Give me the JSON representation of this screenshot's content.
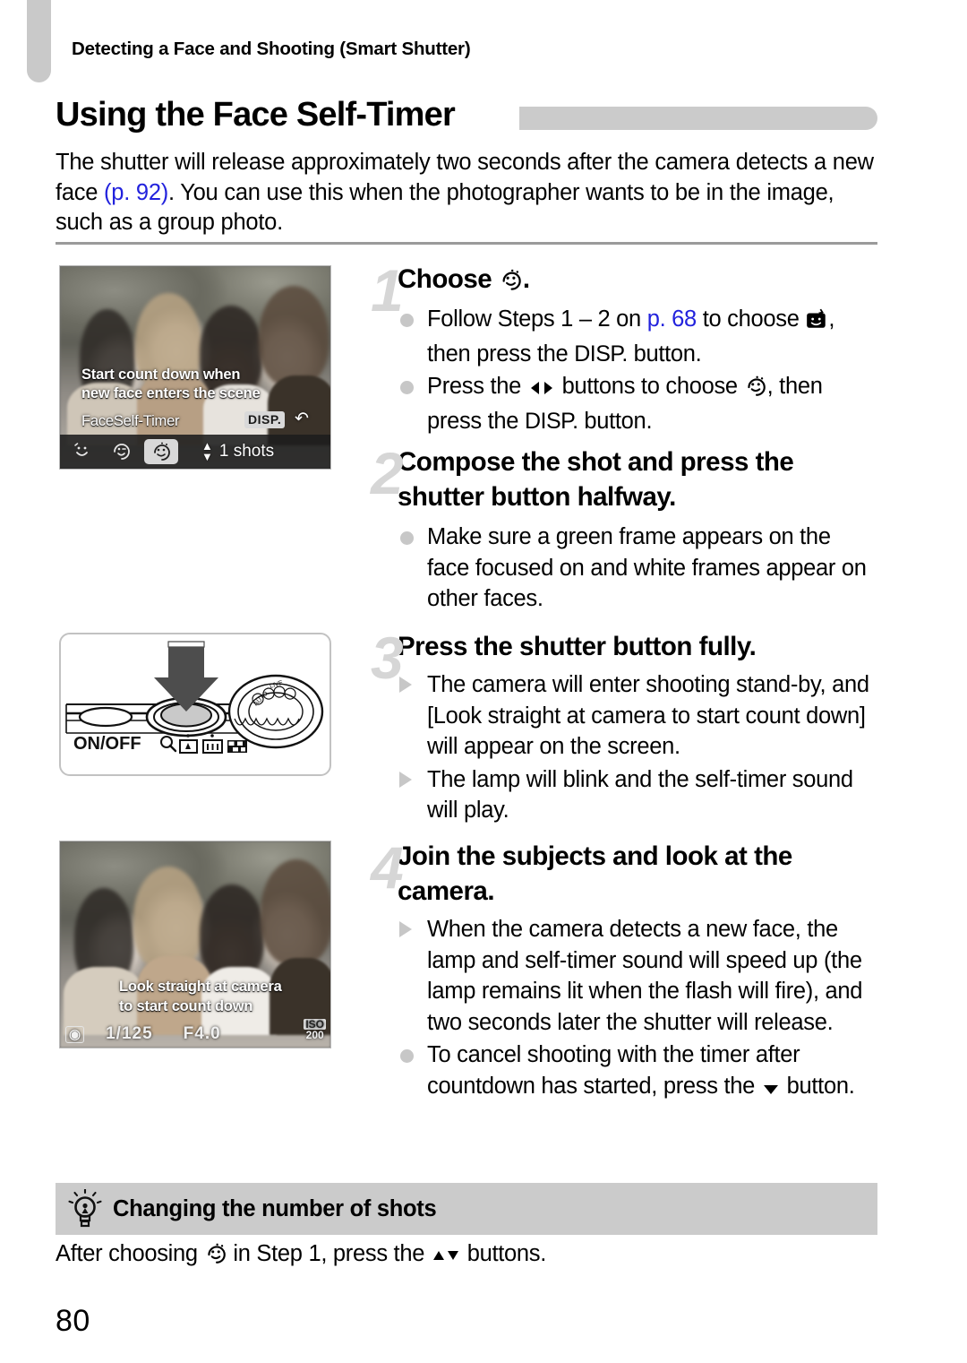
{
  "page": {
    "running_header": "Detecting a Face and Shooting (Smart Shutter)",
    "title": "Using the Face Self-Timer",
    "page_number": "80",
    "intro": {
      "part1": "The shutter will release approximately two seconds after the camera detects a new face ",
      "link": "(p. 92)",
      "part2": ". You can use this when the photographer wants to be in the image, such as a group photo."
    }
  },
  "figures": {
    "lcd_menu": {
      "osd_line1": "Start count down when",
      "osd_line2": "new face enters the scene",
      "mode_label": "FaceSelf-Timer",
      "disp_badge": "DISP.",
      "return_icon": "return-arrow-icon",
      "mode_icons": [
        "smile-shutter-icon",
        "wink-self-timer-icon",
        "face-self-timer-icon"
      ],
      "selected_index": 2,
      "shots_value": "1 shots"
    },
    "camera_top": {
      "onoff_label": "ON/OFF",
      "zoom_icons": [
        "magnifier-icon",
        "tele-zoom-icon",
        "wide-zoom-icon",
        "index-view-icon"
      ],
      "arrow": "press-shutter-arrow-icon"
    },
    "lcd_standby": {
      "osd_line1": "Look straight at camera",
      "osd_line2": "to start count down",
      "shutter_speed": "1/125",
      "aperture": "F4.0",
      "iso_label": "ISO",
      "iso_value": "200",
      "metering_icon": "face-detect-icon"
    }
  },
  "steps": [
    {
      "number": "1",
      "heading_pre": "Choose ",
      "heading_icon": "face-self-timer-icon",
      "heading_post": ".",
      "bullets": [
        {
          "marker": "dot",
          "segments": [
            {
              "type": "text",
              "value": "Follow Steps 1 – 2 on "
            },
            {
              "type": "link",
              "value": "p. 68"
            },
            {
              "type": "text",
              "value": " to choose "
            },
            {
              "type": "icon",
              "value": "smart-shutter-icon"
            },
            {
              "type": "text",
              "value": ", then press the "
            },
            {
              "type": "disp",
              "value": "DISP."
            },
            {
              "type": "text",
              "value": " button."
            }
          ]
        },
        {
          "marker": "dot",
          "segments": [
            {
              "type": "text",
              "value": "Press the "
            },
            {
              "type": "icon",
              "value": "left-right-buttons-icon"
            },
            {
              "type": "text",
              "value": " buttons to choose "
            },
            {
              "type": "icon",
              "value": "face-self-timer-icon"
            },
            {
              "type": "text",
              "value": ", then press the "
            },
            {
              "type": "disp",
              "value": "DISP."
            },
            {
              "type": "text",
              "value": " button."
            }
          ]
        }
      ]
    },
    {
      "number": "2",
      "heading": "Compose the shot and press the shutter button halfway.",
      "bullets": [
        {
          "marker": "dot",
          "segments": [
            {
              "type": "text",
              "value": "Make sure a green frame appears on the face focused on and white frames appear on other faces."
            }
          ]
        }
      ]
    },
    {
      "number": "3",
      "heading": "Press the shutter button fully.",
      "bullets": [
        {
          "marker": "triangle",
          "segments": [
            {
              "type": "text",
              "value": "The camera will enter shooting stand-by, and [Look straight at camera to start count down] will appear on the screen."
            }
          ]
        },
        {
          "marker": "triangle",
          "segments": [
            {
              "type": "text",
              "value": "The lamp will blink and the self-timer sound will play."
            }
          ]
        }
      ]
    },
    {
      "number": "4",
      "heading": "Join the subjects and look at the camera.",
      "bullets": [
        {
          "marker": "triangle",
          "segments": [
            {
              "type": "text",
              "value": "When the camera detects a new face, the lamp and self-timer sound will speed up (the lamp remains lit when the flash will fire), and two seconds later the shutter will release."
            }
          ]
        },
        {
          "marker": "dot",
          "segments": [
            {
              "type": "text",
              "value": "To cancel shooting with the timer after countdown has started, press the "
            },
            {
              "type": "icon",
              "value": "down-button-icon"
            },
            {
              "type": "text",
              "value": " button."
            }
          ]
        }
      ]
    }
  ],
  "tip": {
    "icon": "lightbulb-icon",
    "title": "Changing the number of shots",
    "body_segments": [
      {
        "type": "text",
        "value": "After choosing "
      },
      {
        "type": "icon",
        "value": "face-self-timer-icon"
      },
      {
        "type": "text",
        "value": " in Step 1, press the "
      },
      {
        "type": "icon",
        "value": "up-down-buttons-icon"
      },
      {
        "type": "text",
        "value": " buttons."
      }
    ]
  },
  "colors": {
    "link": "#2222dd",
    "tab_gray": "#c9c9c9",
    "bar_gray": "#cbcbcb",
    "step_number_gray": "#d6d6d6",
    "rule_gray": "#9a9a9a"
  }
}
